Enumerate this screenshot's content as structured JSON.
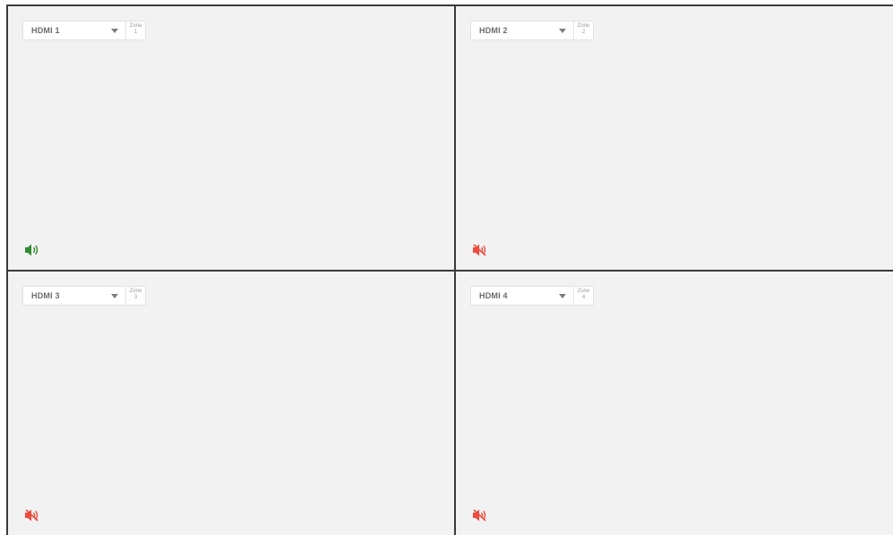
{
  "colors": {
    "grid_background": "#f2f2f2",
    "divider": "#3b3b3b",
    "unmuted": "#2e8b2e",
    "muted": "#ef4a3c"
  },
  "zones": [
    {
      "source": "HDMI 1",
      "zone_label": "Zone",
      "zone_number": "1",
      "audio_state": "unmuted"
    },
    {
      "source": "HDMI 2",
      "zone_label": "Zone",
      "zone_number": "2",
      "audio_state": "muted"
    },
    {
      "source": "HDMI 3",
      "zone_label": "Zone",
      "zone_number": "3",
      "audio_state": "muted"
    },
    {
      "source": "HDMI 4",
      "zone_label": "Zone",
      "zone_number": "4",
      "audio_state": "muted"
    }
  ]
}
